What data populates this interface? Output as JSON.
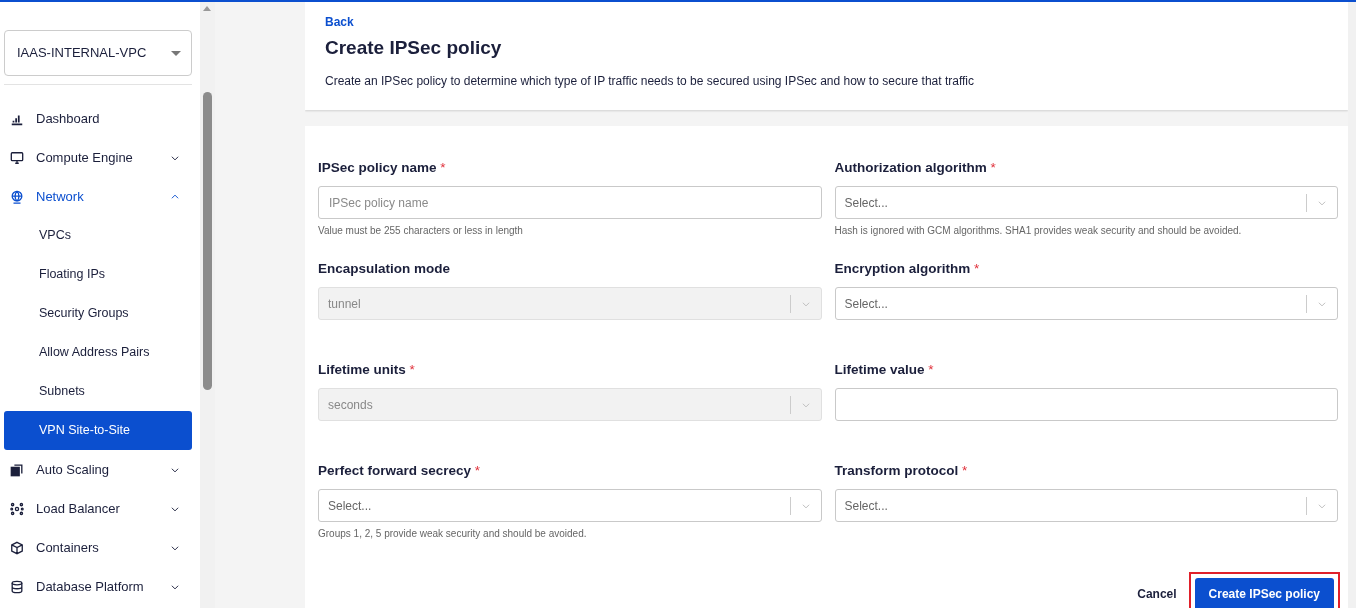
{
  "sidebar": {
    "project_select": {
      "value": "IAAS-INTERNAL-VPC"
    },
    "items": [
      {
        "label": "Dashboard",
        "selected": false
      },
      {
        "label": "Compute Engine",
        "selected": false,
        "expanded": false
      },
      {
        "label": "Network",
        "selected": true,
        "expanded": true,
        "children": [
          {
            "label": "VPCs",
            "selected": false
          },
          {
            "label": "Floating IPs",
            "selected": false
          },
          {
            "label": "Security Groups",
            "selected": false
          },
          {
            "label": "Allow Address Pairs",
            "selected": false
          },
          {
            "label": "Subnets",
            "selected": false
          },
          {
            "label": "VPN Site-to-Site",
            "selected": true
          }
        ]
      },
      {
        "label": "Auto Scaling",
        "selected": false,
        "expanded": false
      },
      {
        "label": "Load Balancer",
        "selected": false,
        "expanded": false
      },
      {
        "label": "Containers",
        "selected": false,
        "expanded": false
      },
      {
        "label": "Database Platform",
        "selected": false,
        "expanded": false
      }
    ]
  },
  "header": {
    "back_link": "Back",
    "title": "Create IPSec policy",
    "description": "Create an IPSec policy to determine which type of IP traffic needs to be secured using IPSec and how to secure that traffic"
  },
  "form": {
    "fields": [
      {
        "kind": "text",
        "label": "IPSec policy name",
        "required_mark": "*",
        "placeholder": "IPSec policy name",
        "hint": "Value must be 255 characters or less in length"
      },
      {
        "kind": "select",
        "label": "Authorization algorithm",
        "required_mark": "*",
        "placeholder": "Select...",
        "disabled": false,
        "hint": "Hash is ignored with GCM algorithms. SHA1 provides weak security and should be avoided."
      },
      {
        "kind": "select",
        "label": "Encapsulation mode",
        "value": "tunnel",
        "disabled": true
      },
      {
        "kind": "select",
        "label": "Encryption algorithm",
        "required_mark": "*",
        "placeholder": "Select...",
        "disabled": false
      },
      {
        "kind": "select",
        "label": "Lifetime units",
        "required_mark": "*",
        "value": "seconds",
        "disabled": true
      },
      {
        "kind": "text",
        "label": "Lifetime value",
        "required_mark": "*"
      },
      {
        "kind": "select",
        "label": "Perfect forward secrecy",
        "required_mark": "*",
        "placeholder": "Select...",
        "disabled": false,
        "hint": "Groups 1, 2, 5 provide weak security and should be avoided."
      },
      {
        "kind": "select",
        "label": "Transform protocol",
        "required_mark": "*",
        "placeholder": "Select...",
        "disabled": false
      }
    ],
    "cancel_button": "Cancel",
    "submit_button": {
      "label": "Create IPSec policy",
      "highlighted": true
    }
  }
}
